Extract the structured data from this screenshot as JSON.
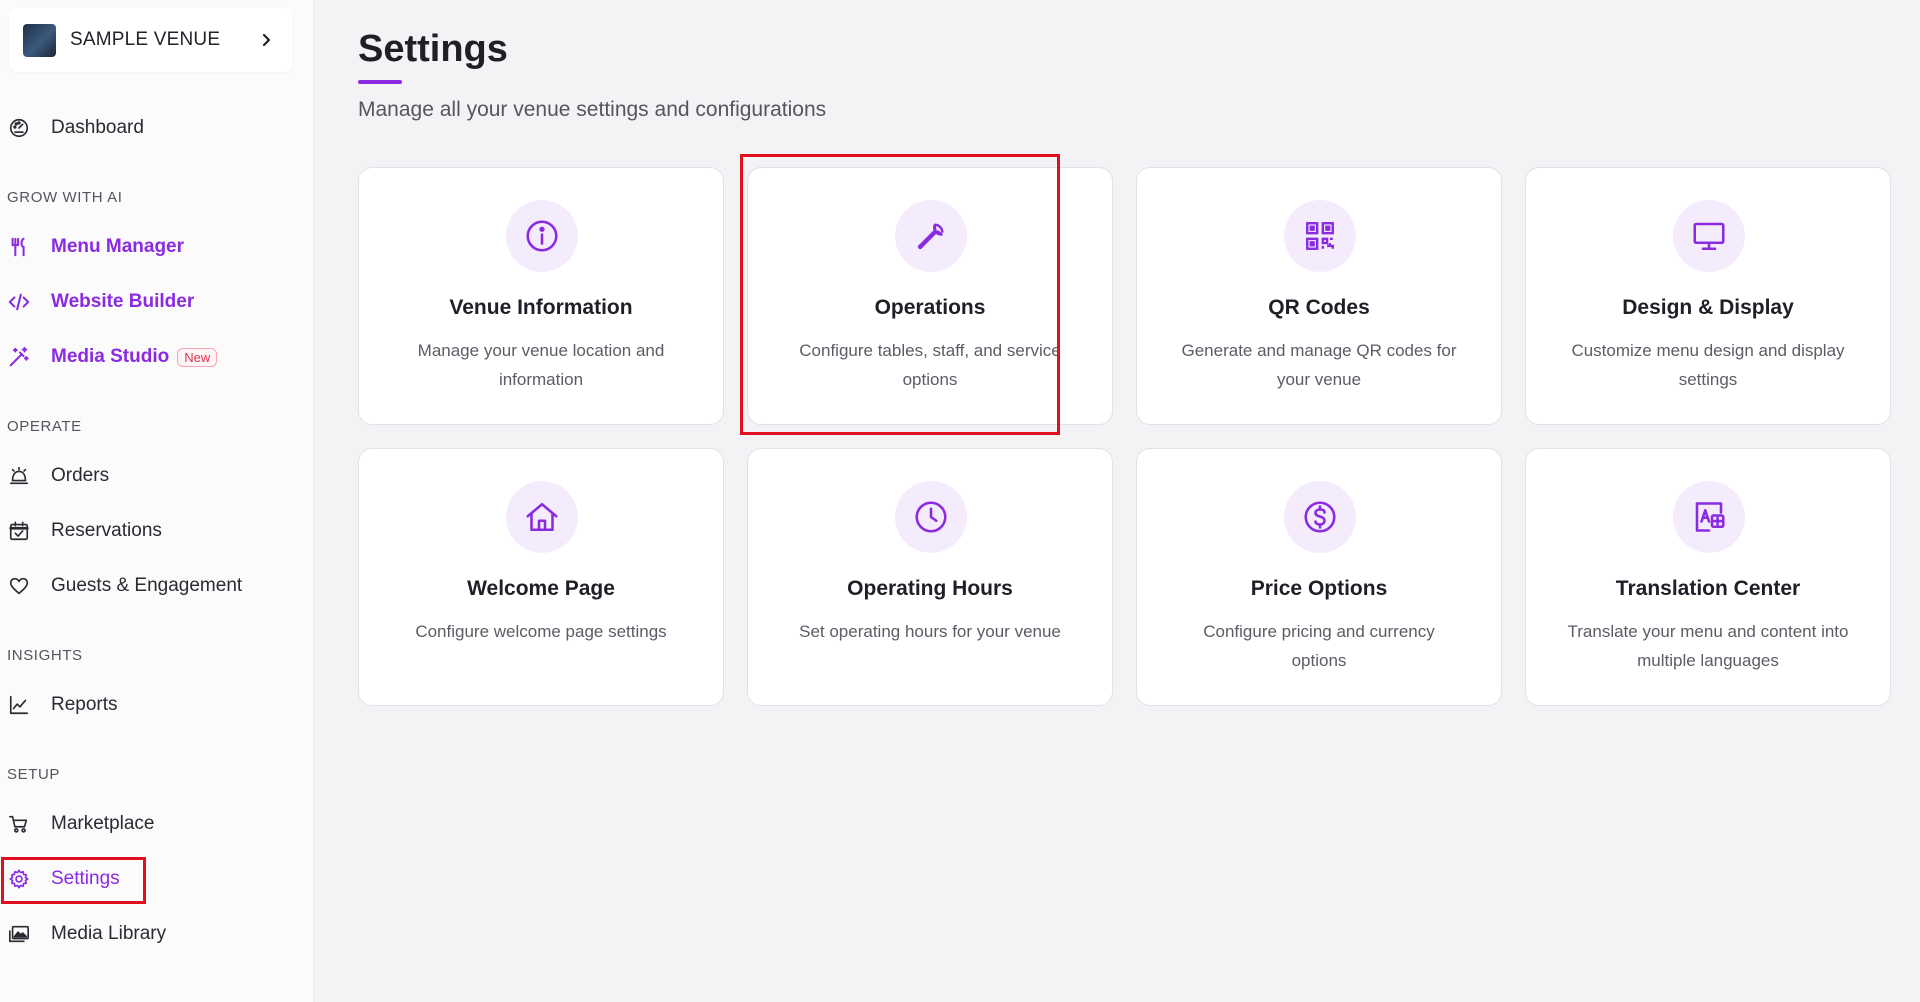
{
  "venue": {
    "name": "SAMPLE VENUE"
  },
  "sidebar": {
    "dashboard": {
      "label": "Dashboard"
    },
    "sections": {
      "grow": "GROW WITH AI",
      "operate": "OPERATE",
      "insights": "INSIGHTS",
      "setup": "SETUP"
    },
    "grow_items": [
      {
        "label": "Menu Manager",
        "icon": "utensils-icon"
      },
      {
        "label": "Website Builder",
        "icon": "code-icon"
      },
      {
        "label": "Media Studio",
        "icon": "magic-wand-icon",
        "badge": "New"
      }
    ],
    "operate_items": [
      {
        "label": "Orders",
        "icon": "bell-icon"
      },
      {
        "label": "Reservations",
        "icon": "calendar-check-icon"
      },
      {
        "label": "Guests & Engagement",
        "icon": "heart-icon"
      }
    ],
    "insights_items": [
      {
        "label": "Reports",
        "icon": "line-chart-icon"
      }
    ],
    "setup_items": [
      {
        "label": "Marketplace",
        "icon": "cart-icon"
      },
      {
        "label": "Settings",
        "icon": "gear-icon",
        "active": true
      },
      {
        "label": "Media Library",
        "icon": "images-icon"
      }
    ]
  },
  "page": {
    "title": "Settings",
    "subtitle": "Manage all your venue settings and configurations"
  },
  "cards": [
    {
      "title": "Venue Information",
      "desc": "Manage your venue location and information",
      "icon": "info-icon"
    },
    {
      "title": "Operations",
      "desc": "Configure tables, staff, and service options",
      "icon": "wrench-icon"
    },
    {
      "title": "QR Codes",
      "desc": "Generate and manage QR codes for your venue",
      "icon": "qr-code-icon"
    },
    {
      "title": "Design & Display",
      "desc": "Customize menu design and display settings",
      "icon": "monitor-icon"
    },
    {
      "title": "Welcome Page",
      "desc": "Configure welcome page settings",
      "icon": "home-icon"
    },
    {
      "title": "Operating Hours",
      "desc": "Set operating hours for your venue",
      "icon": "clock-icon"
    },
    {
      "title": "Price Options",
      "desc": "Configure pricing and currency options",
      "icon": "dollar-icon"
    },
    {
      "title": "Translation Center",
      "desc": "Translate your menu and content into multiple languages",
      "icon": "translate-icon"
    }
  ],
  "colors": {
    "accent": "#8a2be2",
    "highlight": "#e0101e",
    "badge": "#e0334d"
  }
}
